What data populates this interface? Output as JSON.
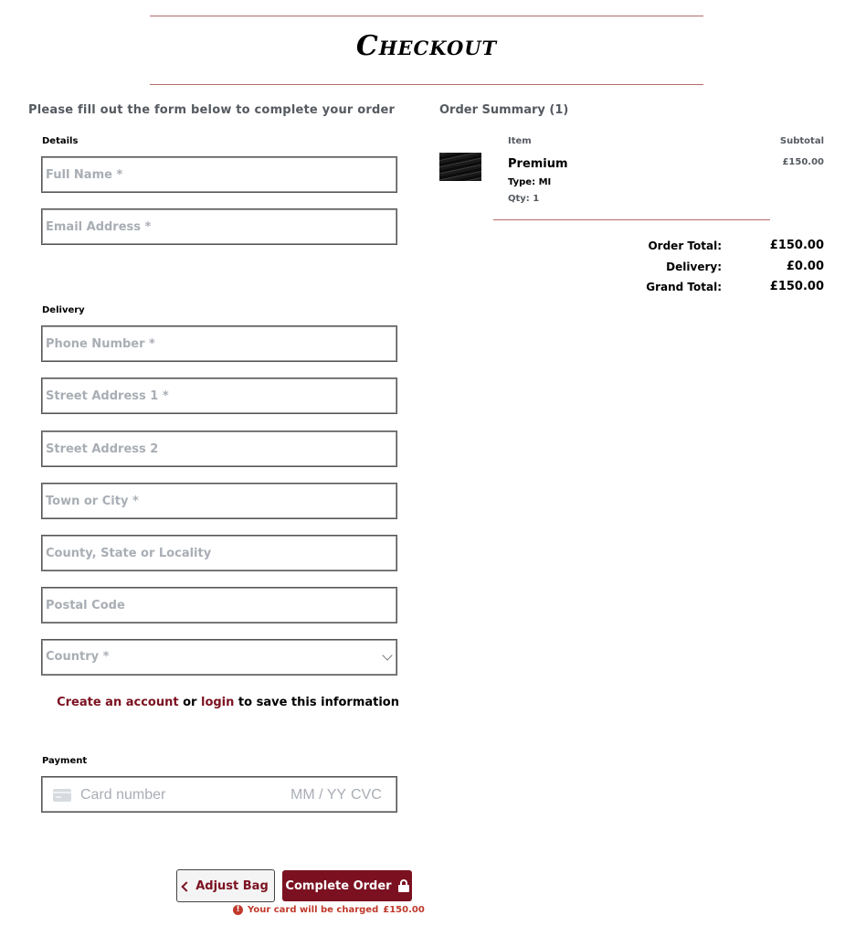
{
  "header": {
    "title": "Checkout"
  },
  "form": {
    "lead": "Please fill out the form below to complete your order",
    "details": {
      "label": "Details",
      "full_name_placeholder": "Full Name *",
      "email_placeholder": "Email Address *"
    },
    "delivery": {
      "label": "Delivery",
      "phone_placeholder": "Phone Number *",
      "street1_placeholder": "Street Address 1 *",
      "street2_placeholder": "Street Address 2",
      "town_placeholder": "Town or City *",
      "county_placeholder": "County, State or Locality",
      "postcode_placeholder": "Postal Code",
      "country_placeholder": "Country *"
    },
    "save_info": {
      "create_account": "Create an account",
      "or": "or",
      "login": "login",
      "suffix": "to save this information"
    },
    "payment": {
      "label": "Payment",
      "card_number_placeholder": "Card number",
      "expiry_placeholder": "MM / YY",
      "cvc_placeholder": "CVC"
    },
    "buttons": {
      "adjust_bag": "Adjust Bag",
      "complete_order": "Complete Order"
    },
    "charge_notice": {
      "prefix": "Your card will be charged",
      "amount": "£150.00"
    }
  },
  "summary": {
    "title": "Order Summary (1)",
    "columns": {
      "item": "Item",
      "subtotal": "Subtotal"
    },
    "items": [
      {
        "name": "Premium",
        "type_label": "Type: MI",
        "qty_label": "Qty: 1",
        "subtotal": "£150.00",
        "thumbnail": "product-thumbnail-dark"
      }
    ],
    "totals": {
      "order_total_label": "Order Total:",
      "order_total": "£150.00",
      "delivery_label": "Delivery:",
      "delivery": "£0.00",
      "grand_total_label": "Grand Total:",
      "grand_total": "£150.00"
    }
  },
  "colors": {
    "brand": "#7b1120",
    "divider": "#b86a6a",
    "warning": "#c0392b",
    "muted_text": "#555a60",
    "placeholder": "#a9aeb5"
  },
  "icons": {
    "adjust_bag": "chevron-left-icon",
    "complete_order": "lock-icon",
    "charge_notice": "exclamation-circle-icon",
    "card": "credit-card-icon",
    "country_select": "chevron-down-icon"
  }
}
